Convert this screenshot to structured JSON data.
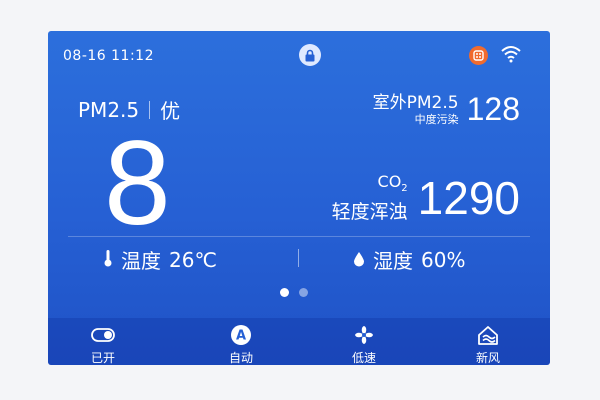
{
  "status": {
    "time": "08-16 11:12"
  },
  "pm": {
    "label": "PM2.5",
    "quality": "优",
    "value": "8"
  },
  "outdoor": {
    "label": "室外PM2.5",
    "sub": "中度污染",
    "value": "128"
  },
  "co2": {
    "label": "CO",
    "sub_2": "2",
    "quality": "轻度浑浊",
    "value": "1290"
  },
  "temperature": {
    "label": "温度",
    "value": "26℃"
  },
  "humidity": {
    "label": "湿度",
    "value": "60%"
  },
  "pager": {
    "count": 2,
    "active": 0
  },
  "nav": [
    {
      "label": "已开",
      "icon": "toggle-icon"
    },
    {
      "label": "自动",
      "icon": "auto-icon"
    },
    {
      "label": "低速",
      "icon": "fan-icon"
    },
    {
      "label": "新风",
      "icon": "fresh-air-icon"
    }
  ],
  "colors": {
    "background": "#2660d4",
    "badge": "#f06b2e"
  }
}
